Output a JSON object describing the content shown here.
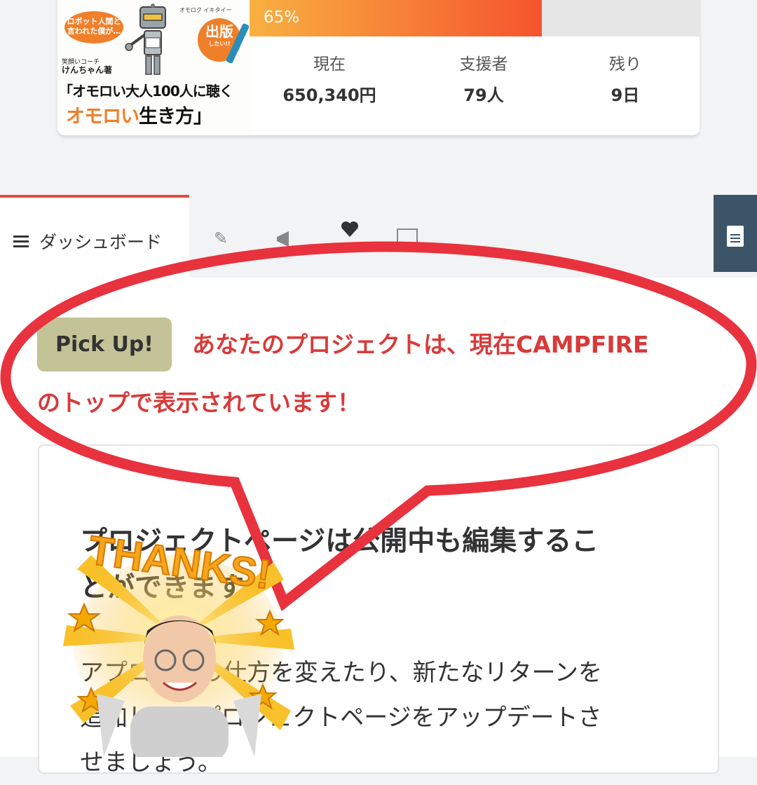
{
  "project": {
    "thumbnail": {
      "bubble_text": "ロボット人間と 言われた僕が…",
      "tagline": "オモロク イキタイー",
      "stamp_main": "出版",
      "stamp_sub": "したい!!",
      "author_role": "笑顔いコーチ",
      "author_name": "けんちゃん著",
      "title_line1": "「オモロい大人100人に聴く",
      "title_line2_a": "オモロい",
      "title_line2_b": "生き方",
      "title_line2_c": "」"
    },
    "progress": {
      "percent_label": "65%",
      "fraction": 0.65
    },
    "stats": [
      {
        "label": "現在",
        "value": "650,340円"
      },
      {
        "label": "支援者",
        "value": "79人"
      },
      {
        "label": "残り",
        "value": "9日"
      }
    ]
  },
  "tabs": {
    "dashboard_label": "ダッシュボード",
    "icons": [
      "menu-icon",
      "pencil-icon",
      "megaphone-icon",
      "heart-icon",
      "mail-icon",
      "document-icon"
    ]
  },
  "pickup": {
    "badge": "Pick Up!",
    "message_line1": "あなたのプロジェクトは、現在CAMPFIRE",
    "message_line2": "のトップで表示されています！"
  },
  "info": {
    "title_line1": "プロジェクトページは公開中も編集するこ",
    "title_line2": "とができます。",
    "body_line1": "アプローチの仕方を変えたり、新たなリターンを",
    "body_line2": "追加して、プロジェクトページをアップデートさ",
    "body_line3": "せましょう。"
  },
  "overlay": {
    "sticker_text": "THANKS!"
  },
  "colors": {
    "accent_red": "#e24c3c",
    "pickup_text": "#d83a3a",
    "badge_bg": "#c4c397",
    "callout_stroke": "#e8323e",
    "progress_start": "#f9b040",
    "progress_end": "#f5542e"
  }
}
